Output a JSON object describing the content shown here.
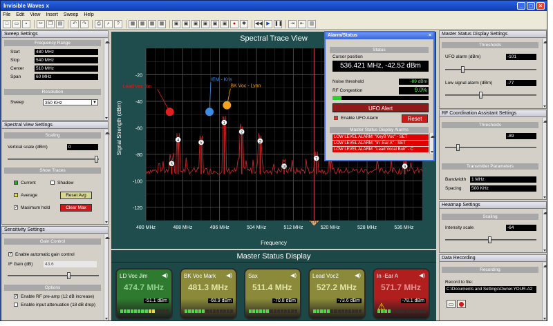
{
  "app": {
    "title": "Invisible Waves x"
  },
  "menu": [
    "File",
    "Edit",
    "View",
    "Insert",
    "Sweep",
    "Help"
  ],
  "sweep_settings": {
    "title": "Sweep Settings",
    "section_range": "Frequency Range",
    "start_label": "Start",
    "start": "480 MHz",
    "stop_label": "Stop",
    "stop": "540 MHz",
    "center_label": "Center",
    "center": "510 MHz",
    "span_label": "Span",
    "span": "60 MHz",
    "section_resolution": "Resolution",
    "sweep_label": "Sweep",
    "sweep": "350 KHz"
  },
  "spectral_view": {
    "title": "Spectral View Settings",
    "section_scaling": "Scaling",
    "vscale_label": "Vertical scale (dBm)",
    "vscale": "0",
    "section_traces": "Show Traces",
    "current": "Current",
    "shadow": "Shadow",
    "average": "Average",
    "reset_avg": "Reset Avg",
    "max_hold": "Maximum hold",
    "clear_max": "Clear Max"
  },
  "sensitivity": {
    "title": "Sensitivity Settings",
    "section_gain": "Gain Control",
    "auto_gain": "Enable automatic gain control",
    "if_gain_label": "IF Gain (dB)",
    "if_gain": "43.6",
    "section_options": "Options",
    "rf_preamp": "Enable RF pre-amp (12 dB increase)",
    "input_atten": "Enable input attenuation (18 dB drop)"
  },
  "chart_title": "Spectral Trace View",
  "chart_data": {
    "type": "line",
    "title": "Spectral Trace View",
    "xlabel": "Frequency",
    "ylabel": "Signal Strength (dBm)",
    "xlim": [
      480,
      540
    ],
    "ylim": [
      -130,
      0
    ],
    "xticks": [
      "480 MHz",
      "488 MHz",
      "496 MHz",
      "504 MHz",
      "512 MHz",
      "520 MHz",
      "528 MHz",
      "536 MHz"
    ],
    "yticks": [
      "-20",
      "-40",
      "-60",
      "-80",
      "-100",
      "-120"
    ],
    "peaks": [
      {
        "x": 485.6,
        "y": -87,
        "label": "5"
      },
      {
        "x": 487.0,
        "y": -69,
        "label": "4"
      },
      {
        "x": 492.0,
        "y": -71,
        "label": "5"
      },
      {
        "x": 497.0,
        "y": -56,
        "label": "1"
      },
      {
        "x": 500.8,
        "y": -63,
        "label": "2"
      },
      {
        "x": 504.8,
        "y": -70,
        "label": "3"
      },
      {
        "x": 510.0,
        "y": -89,
        "label": "10"
      },
      {
        "x": 517.0,
        "y": -83,
        "label": "7"
      },
      {
        "x": 536.2,
        "y": -89,
        "label": "9"
      }
    ],
    "markers": [
      {
        "name": "Lead Voc Jim",
        "x": 485.2,
        "y": -48,
        "color": "#e02020"
      },
      {
        "name": "IEM - Kris",
        "x": 493.8,
        "y": -48,
        "color": "#3a8ee8"
      },
      {
        "name": "BK Voc - Lynn",
        "x": 497.6,
        "y": -43,
        "color": "#f4a020"
      }
    ],
    "cursor_x": 516.5,
    "cursor_label": "CTL"
  },
  "alarm": {
    "title": "Alarm/Status",
    "section_status": "Status",
    "cursor_label": "Cursor position",
    "cursor_value": "536.421 MHz, -42.52 dBm",
    "noise_label": "Noise threshold",
    "noise_value": "-89 dBm",
    "congestion_label": "RF Congestion",
    "congestion_value": "9.0%",
    "ufo_alert": "UFO Alert",
    "enable_ufo": "Enable UFO Alarm",
    "reset": "Reset",
    "section_master": "Master Status Display Alarms",
    "alarms": [
      "LOW LEVEL ALARM: \"KeyB Voc\" - SET",
      "LOW LEVEL ALARM: \"In -Ear A\" - SET",
      "LOW LEVEL ALARM: \"Lead Vocal Bob\" - C"
    ]
  },
  "master_status": {
    "title": "Master Status Display",
    "cards": [
      {
        "name": "LD Voc Jim",
        "freq": "474.7 MHz",
        "dbm": "-51.1 dBm",
        "bg": "#2e7a2e",
        "fc": "#8ed08e"
      },
      {
        "name": "BK Voc Mark",
        "freq": "481.3 MHz",
        "dbm": "-68.9 dBm",
        "bg": "#8a8a3a",
        "fc": "#e4e4a4"
      },
      {
        "name": "Sax",
        "freq": "511.4 MHz",
        "dbm": "-70.8 dBm",
        "bg": "#8a8a3a",
        "fc": "#e4e4a4"
      },
      {
        "name": "Lead Voc2",
        "freq": "527.2 MHz",
        "dbm": "-73.6 dBm",
        "bg": "#8a8a3a",
        "fc": "#e4e4a4"
      },
      {
        "name": "In -Ear A",
        "freq": "571.7 MHz",
        "dbm": "-78.1 dBm",
        "bg": "#b01e1e",
        "fc": "#f09090"
      }
    ]
  },
  "msd_settings": {
    "title": "Master Status Display Settings",
    "section": "Thresholds",
    "ufo_label": "UFO alarm (dBm)",
    "ufo_value": "-101",
    "low_label": "Low signal alarm (dBm)",
    "low_value": "-77"
  },
  "rfca": {
    "title": "RF Coordination Assistant Settings",
    "section": "Thresholds",
    "value": "-89",
    "section_tx": "Transmitter Parameters",
    "bw_label": "Bandwidth",
    "bw_value": "1 MHz",
    "sp_label": "Spacing",
    "sp_value": "500 KHz"
  },
  "heatmap": {
    "title": "Heatmap Settings",
    "section": "Scaling",
    "intensity_label": "Intensity scale",
    "intensity_value": "-64"
  },
  "recording": {
    "title": "Data Recording",
    "section": "Recording",
    "record_label": "Record to file:",
    "path": "C:\\Documents and Settings\\Owner.YOUR-A2"
  }
}
